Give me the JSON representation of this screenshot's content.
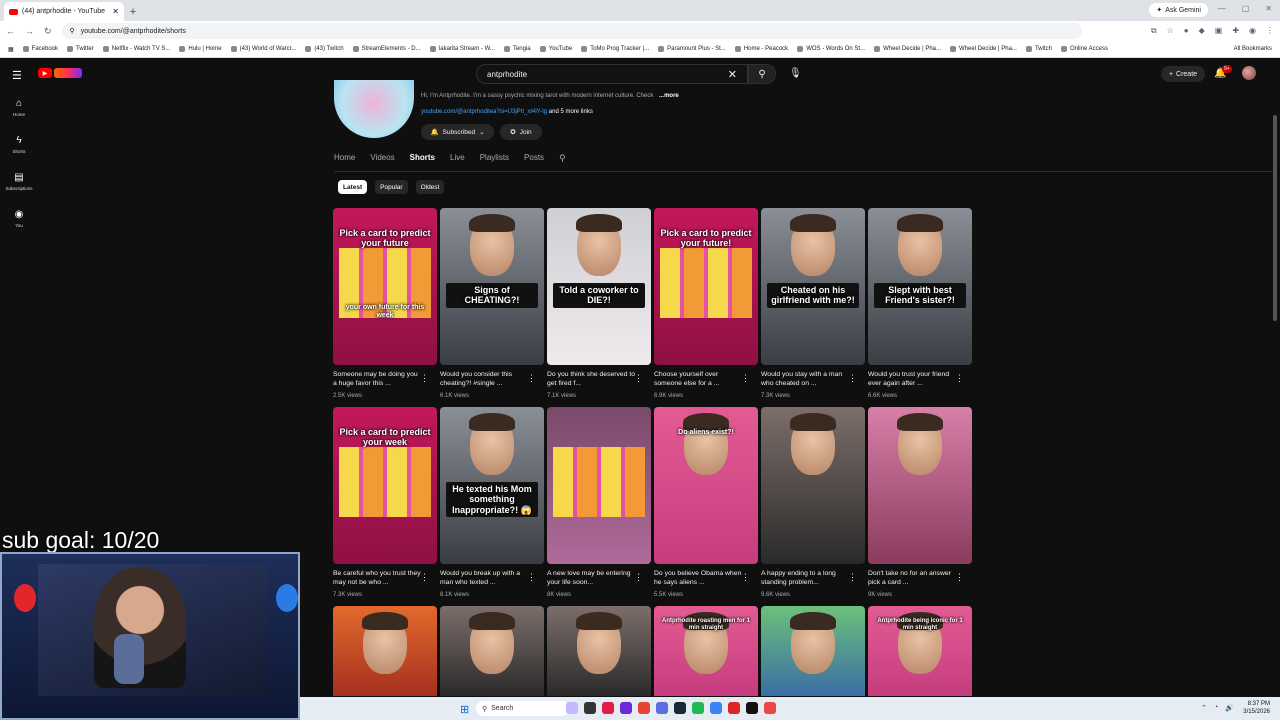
{
  "browser": {
    "tab_title": "(44) antprhodite - YouTube",
    "new_tab": "+",
    "url": "youtube.com/@antprhodite/shorts",
    "ask_gemini": "Ask Gemini",
    "bookmarks": [
      "Facebook",
      "Twitter",
      "Netflix - Watch TV S...",
      "Hulu | Home",
      "(43) World of Warcr...",
      "(43) Twitch",
      "StreamElements - D...",
      "Iakarita Stream - W...",
      "Tengia",
      "YouTube",
      "ToMo Prog Tracker |...",
      "Paramount Plus - St...",
      "Home - Peacock",
      "WOS - Words On St...",
      "Wheel Decide | Pha...",
      "Wheel Decide | Pha...",
      "Twitch",
      "Online Access"
    ],
    "all_bookmarks": "All Bookmarks"
  },
  "youtube": {
    "search_value": "antprhodite",
    "create_label": "Create",
    "notif_count": "9+",
    "sidebar": [
      {
        "label": "Home",
        "icon": "home-icon"
      },
      {
        "label": "Shorts",
        "icon": "shorts-icon"
      },
      {
        "label": "Subscriptions",
        "icon": "subscriptions-icon"
      },
      {
        "label": "You",
        "icon": "you-icon"
      }
    ]
  },
  "channel": {
    "bio": "Hi, I'm Antprhodite. I'm a sassy psychic mixing tarot with modern internet culture. Check",
    "more": "...more",
    "link": "youtube.com/@antprhoditea?si=U3jPIt_xt4lY-Ig",
    "link_more": "and 5 more links",
    "subscribed_label": "Subscribed",
    "join_label": "Join",
    "tabs": [
      "Home",
      "Videos",
      "Shorts",
      "Live",
      "Playlists",
      "Posts"
    ],
    "active_tab": "Shorts",
    "chips": [
      "Latest",
      "Popular",
      "Oldest"
    ],
    "selected_chip": "Latest"
  },
  "shorts": [
    {
      "title": "Someone may be doing you a huge favor this ...",
      "views": "2.5K views",
      "caption": "Pick a card to predict your future",
      "caption2": "your own future for this week",
      "style": "tarot"
    },
    {
      "title": "Would you consider this cheating?! #single ...",
      "views": "6.1K views",
      "caption": "Signs of CHEATING?!",
      "style": "face-box"
    },
    {
      "title": "Do you think she deserved to get fired f...",
      "views": "7.1K views",
      "caption": "Told a coworker to DIE?!",
      "style": "face-box-light"
    },
    {
      "title": "Choose yourself over someone else for a ...",
      "views": "6.9K views",
      "caption": "Pick a card to predict your future!",
      "style": "tarot"
    },
    {
      "title": "Would you stay with a man who cheated on ...",
      "views": "7.3K views",
      "caption": "Cheated on his girlfriend with me?!",
      "style": "face-box"
    },
    {
      "title": "Would you trust your friend ever again after ...",
      "views": "6.6K views",
      "caption": "Slept with best Friend's sister?!",
      "style": "face-box"
    },
    {
      "title": "Be careful who you trust they may not be who ...",
      "views": "7.3K views",
      "caption": "Pick a card to predict your week",
      "style": "tarot"
    },
    {
      "title": "Would you break up with a man who texted ...",
      "views": "8.1K views",
      "caption": "He texted his Mom something Inappropriate?! 😱",
      "style": "face-box"
    },
    {
      "title": "A new love may be entering your life soon...",
      "views": "8K views",
      "caption": "",
      "style": "tarot-purple"
    },
    {
      "title": "Do you believe Obama when he says aliens ...",
      "views": "5.5K views",
      "caption": "Do aliens exist?!",
      "style": "face-pink"
    },
    {
      "title": "A happy ending to a long standing problem...",
      "views": "9.6K views",
      "caption": "",
      "style": "face-cards"
    },
    {
      "title": "Don't take no for an answer pick a card ...",
      "views": "9K views",
      "caption": "",
      "style": "face-cards-pink"
    },
    {
      "title": "",
      "views": "",
      "caption": "",
      "style": "fire"
    },
    {
      "title": "",
      "views": "",
      "caption": "",
      "style": "face-cards"
    },
    {
      "title": "",
      "views": "",
      "caption": "",
      "style": "face-cards"
    },
    {
      "title": "",
      "views": "",
      "caption": "Antprhodite roasting men for 1 min straight",
      "style": "face-pink"
    },
    {
      "title": "",
      "views": "",
      "caption": "",
      "style": "face-green"
    },
    {
      "title": "",
      "views": "",
      "caption": "Antprhodite being iconic for 1 min straight",
      "style": "face-pink"
    }
  ],
  "overlay": {
    "sub_goal": "sub goal: 10/20"
  },
  "taskbar": {
    "search_label": "Search",
    "time": "8:37 PM",
    "date": "3/15/2026"
  },
  "colors": {
    "background": "#0f0f0f",
    "youtube_red": "#ff0000",
    "link_blue": "#3ea6ff",
    "tarot_pink": "#c2185b"
  }
}
